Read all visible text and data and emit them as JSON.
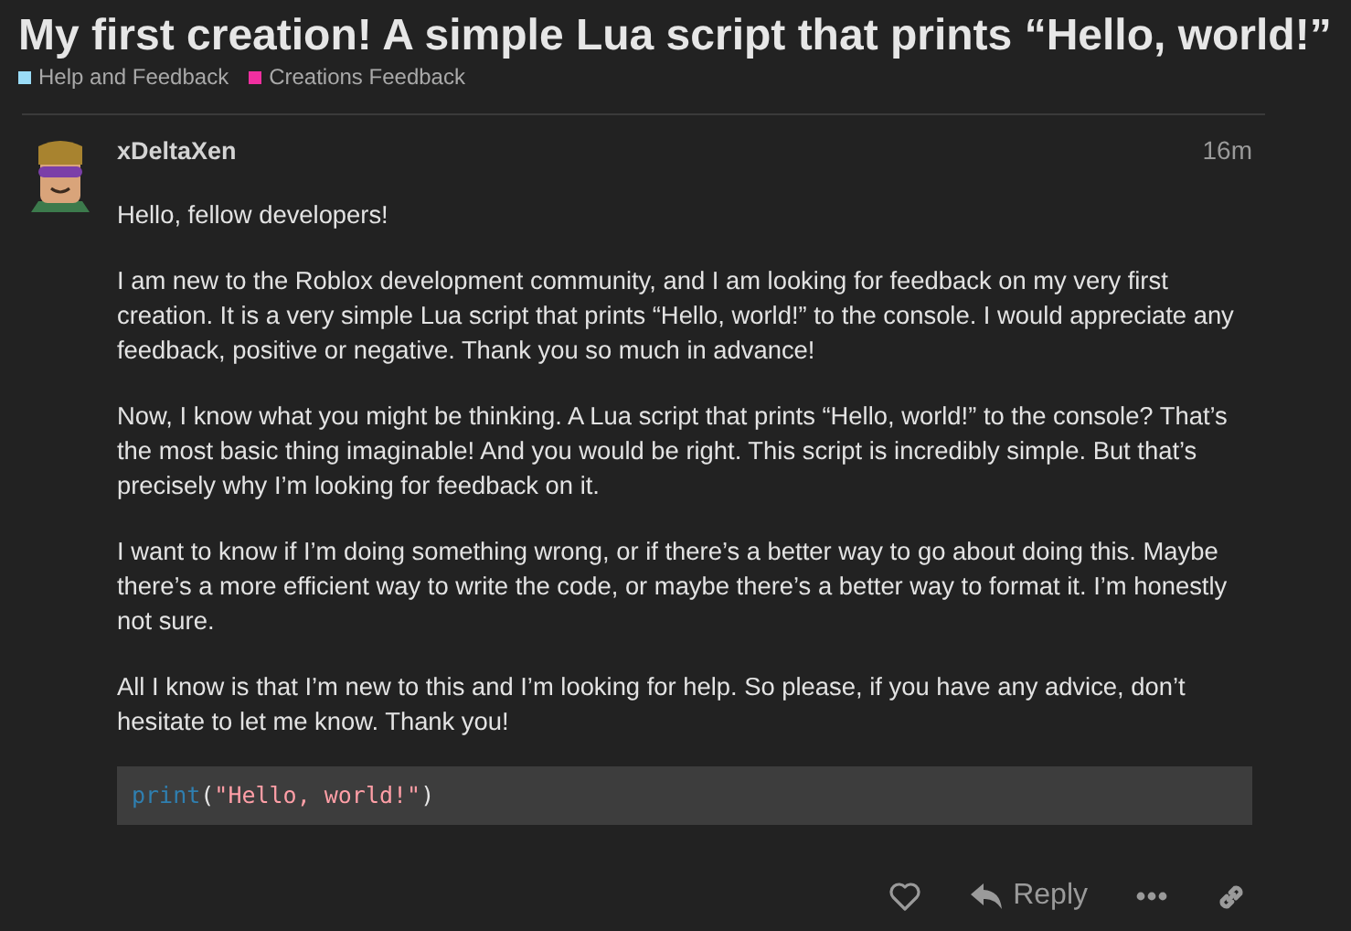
{
  "topic": {
    "title": "My first creation! A simple Lua script that prints “Hello, world!”",
    "categories": [
      {
        "label": "Help and Feedback",
        "color": "#9adcf7"
      },
      {
        "label": "Creations Feedback",
        "color": "#f02fa0"
      }
    ]
  },
  "post": {
    "username": "xDeltaXen",
    "time": "16m",
    "paragraphs": [
      "Hello, fellow developers!",
      "I am new to the Roblox development community, and I am looking for feedback on my very first creation. It is a very simple Lua script that prints “Hello, world!” to the console. I would appreciate any feedback, positive or negative. Thank you so much in advance!",
      "Now, I know what you might be thinking. A Lua script that prints “Hello, world!” to the console? That’s the most basic thing imaginable! And you would be right. This script is incredibly simple. But that’s precisely why I’m looking for feedback on it.",
      "I want to know if I’m doing something wrong, or if there’s a better way to go about doing this. Maybe there’s a more efficient way to write the code, or maybe there’s a better way to format it. I’m honestly not sure.",
      "All I know is that I’m new to this and I’m looking for help. So please, if you have any advice, don’t hesitate to let me know. Thank you!"
    ],
    "code": [
      {
        "text": "print",
        "kind": "builtin"
      },
      {
        "text": "(",
        "kind": "punct"
      },
      {
        "text": "\"Hello, world!\"",
        "kind": "string"
      },
      {
        "text": ")",
        "kind": "punct"
      }
    ],
    "actions": {
      "reply": "Reply"
    }
  }
}
